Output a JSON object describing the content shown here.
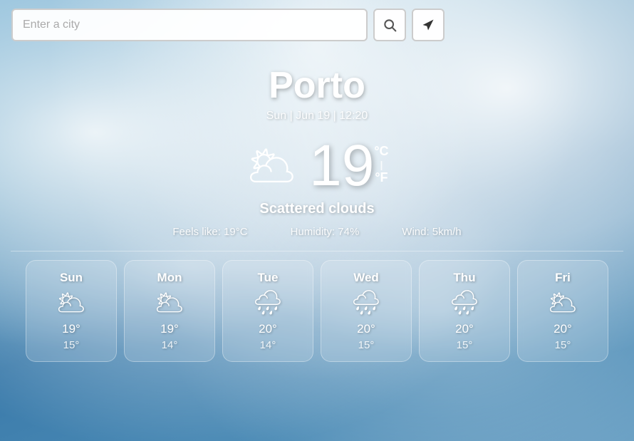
{
  "search": {
    "placeholder": "Enter a city",
    "search_label": "🔍",
    "location_label": "➤"
  },
  "current": {
    "city": "Porto",
    "datetime": "Sun | Jun 19 | 12:20",
    "temperature": "19",
    "unit_c": "°C",
    "unit_f": "°F",
    "unit_separator": "|",
    "condition": "Scattered clouds",
    "feels_like": "Feels like: 19°C",
    "humidity": "Humidity: 74%",
    "wind": "Wind: 5km/h",
    "icon": "🌥"
  },
  "forecast": [
    {
      "day": "Sun",
      "icon": "🌥",
      "high": "19°",
      "low": "15°"
    },
    {
      "day": "Mon",
      "icon": "🌥",
      "high": "19°",
      "low": "14°"
    },
    {
      "day": "Tue",
      "icon": "🌧",
      "high": "20°",
      "low": "14°"
    },
    {
      "day": "Wed",
      "icon": "🌧",
      "high": "20°",
      "low": "15°"
    },
    {
      "day": "Thu",
      "icon": "🌧",
      "high": "20°",
      "low": "15°"
    },
    {
      "day": "Fri",
      "icon": "🌥",
      "high": "20°",
      "low": "15°"
    }
  ]
}
